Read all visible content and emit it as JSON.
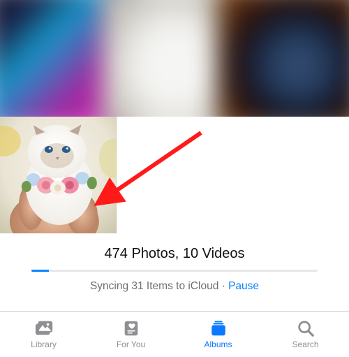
{
  "summary": {
    "text": "474 Photos, 10 Videos"
  },
  "sync": {
    "status": "Syncing 31 Items to iCloud",
    "separator": " · ",
    "pause_label": "Pause",
    "progress_percent": "6%"
  },
  "tabs": {
    "library": "Library",
    "for_you": "For You",
    "albums": "Albums",
    "search": "Search"
  }
}
